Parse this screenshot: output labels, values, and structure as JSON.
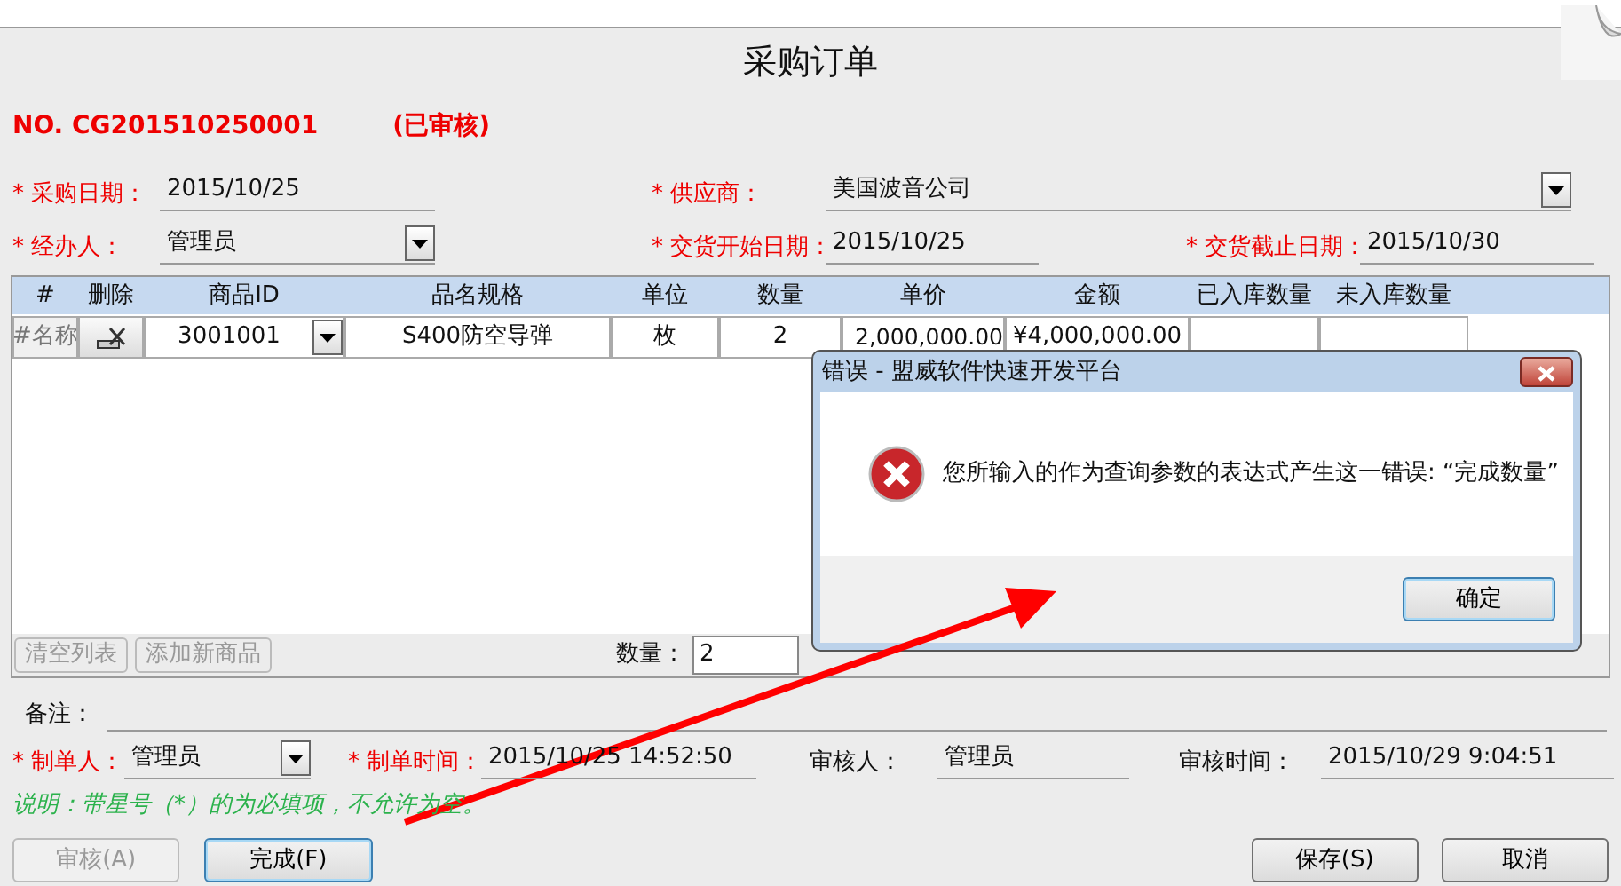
{
  "window": {
    "title": "采购订单"
  },
  "order": {
    "number": "NO. CG201510250001",
    "status": "(已审核)"
  },
  "header_rows": [
    [
      {
        "label": "* 采购日期：",
        "value": "2015/10/25",
        "required": true,
        "kind": "text"
      },
      {
        "label": "* 供应商：",
        "value": "美国波音公司",
        "required": true,
        "kind": "dropdown"
      }
    ],
    [
      {
        "label": "* 经办人：",
        "value": "管理员",
        "required": true,
        "kind": "dropdown"
      },
      {
        "label": "* 交货开始日期：",
        "value": "2015/10/25",
        "required": true,
        "kind": "text"
      },
      {
        "label": "* 交货截止日期：",
        "value": "2015/10/30",
        "required": true,
        "kind": "text"
      }
    ]
  ],
  "grid": {
    "columns": [
      "#",
      "删除",
      "商品ID",
      "品名规格",
      "单位",
      "数量",
      "单价",
      "金额",
      "已入库数量",
      "未入库数量"
    ],
    "rows": [
      {
        "cells": [
          {
            "kind": "rowhead",
            "text": "#名称"
          },
          {
            "kind": "delete"
          },
          {
            "kind": "dropdown",
            "text": "3001001"
          },
          {
            "kind": "text",
            "text": "S400防空导弹"
          },
          {
            "kind": "text",
            "text": "枚"
          },
          {
            "kind": "text",
            "text": "2"
          },
          {
            "kind": "text",
            "text": "2,000,000.00"
          },
          {
            "kind": "text",
            "text": "¥4,000,000.00"
          },
          {
            "kind": "empty"
          },
          {
            "kind": "empty"
          }
        ]
      }
    ],
    "buttons": [
      {
        "label": "清空列表",
        "disabled": true
      },
      {
        "label": "添加新商品",
        "disabled": true
      }
    ],
    "quantity": {
      "label": "数量：",
      "value": "2"
    }
  },
  "remark": {
    "label": "备注："
  },
  "footer_fields": [
    {
      "label": "* 制单人：",
      "value": "管理员",
      "required": true,
      "kind": "dropdown"
    },
    {
      "label": "* 制单时间：",
      "value": "2015/10/25 14:52:50",
      "required": true,
      "kind": "text"
    },
    {
      "label": "审核人：",
      "value": "管理员",
      "required": false,
      "kind": "text"
    },
    {
      "label": "审核时间：",
      "value": "2015/10/29 9:04:51",
      "required": false,
      "kind": "text"
    }
  ],
  "note": "说明：带星号（*）的为必填项，不允许为空。",
  "buttons": [
    {
      "label": "审核(A)",
      "disabled": true,
      "default": false
    },
    {
      "label": "完成(F)",
      "disabled": false,
      "default": true
    },
    {
      "label": "保存(S)",
      "disabled": false,
      "default": false
    },
    {
      "label": "取消",
      "disabled": false,
      "default": false
    }
  ],
  "dialog": {
    "title": "错误 - 盟威软件快速开发平台",
    "message": "您所输入的作为查询参数的表达式产生这一错误: “完成数量”",
    "button": "确定"
  }
}
